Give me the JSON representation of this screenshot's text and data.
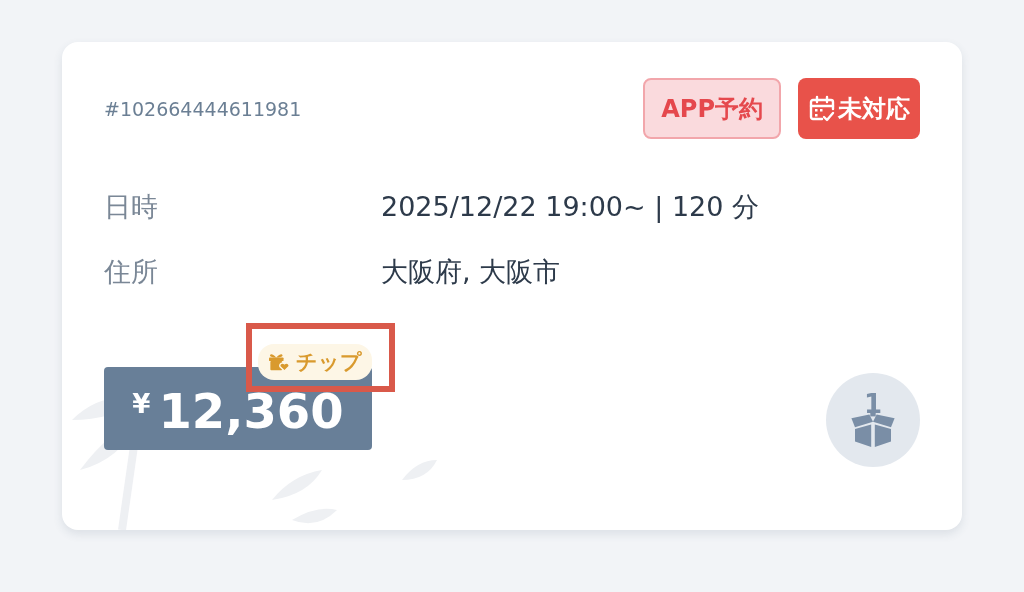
{
  "order": {
    "id": "#102664444611981",
    "badges": [
      {
        "kind": "source",
        "label": "APP予約"
      },
      {
        "kind": "status",
        "label": "未対応"
      }
    ],
    "details": [
      {
        "label": "日時",
        "value": "2025/12/22 19:00~ | 120 分"
      },
      {
        "label": "住所",
        "value": "大阪府, 大阪市"
      }
    ],
    "price": {
      "currency": "¥",
      "amount": "12,360"
    },
    "tip": {
      "label": "チップ",
      "highlighted": true
    },
    "item_count": "1"
  }
}
